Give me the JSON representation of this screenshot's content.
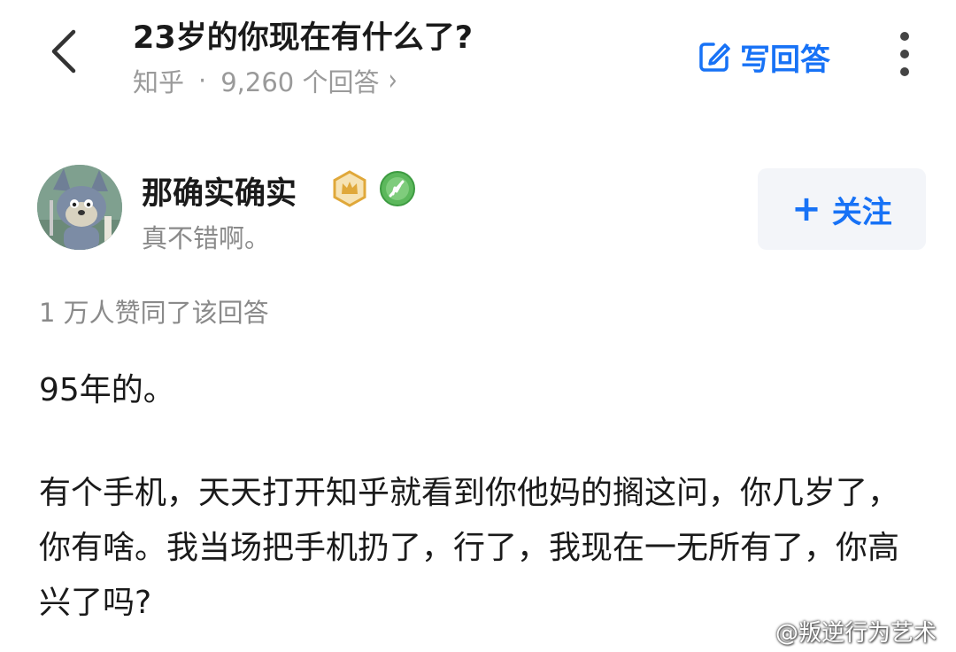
{
  "header": {
    "question_title": "23岁的你现在有什么了?",
    "source": "知乎",
    "separator": "·",
    "answer_count": "9,260 个回答",
    "chevron": "›",
    "write_answer_label": "写回答",
    "write_answer_icon": "edit-icon",
    "more_icon": "more-vertical-icon",
    "back_icon": "chevron-left-icon"
  },
  "author": {
    "name": "那确实确实",
    "bio": "真不错啊。",
    "follow_label": "关注",
    "follow_plus": "+",
    "badges": [
      "crown-badge-icon",
      "feather-badge-icon"
    ]
  },
  "answer": {
    "voteup_text": "1 万人赞同了该回答",
    "paragraphs": [
      "95年的。",
      "有个手机，天天打开知乎就看到你他妈的搁这问，你几岁了，你有啥。我当场把手机扔了，行了，我现在一无所有了，你高兴了吗?"
    ]
  },
  "watermark": {
    "text": "@叛逆行为艺术"
  },
  "colors": {
    "accent": "#1772f6",
    "text_primary": "#1a1a1a",
    "text_secondary": "#8a8a8a",
    "follow_bg": "#f3f5f9"
  }
}
